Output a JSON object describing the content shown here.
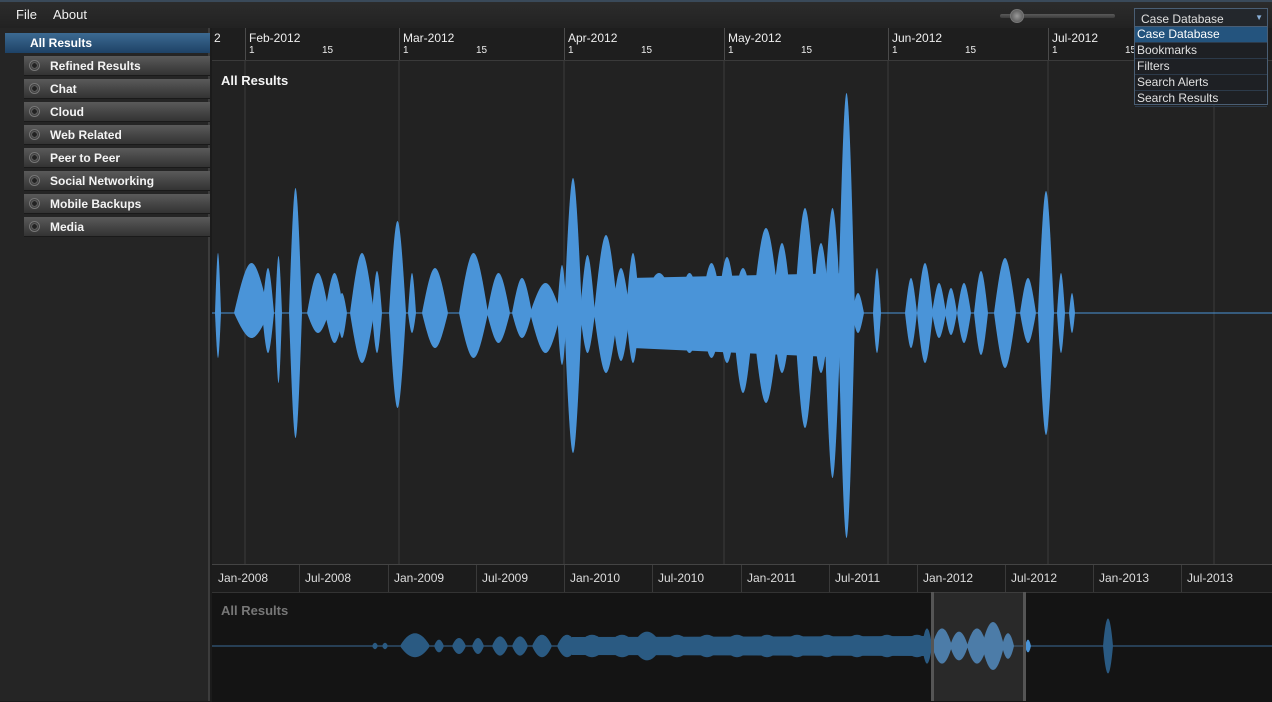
{
  "menu": {
    "file": "File",
    "about": "About"
  },
  "toolbar": {
    "zoom_icon": "magnifier-slider-icon"
  },
  "source_select": {
    "value": "Case Database",
    "options": [
      "Case Database",
      "Bookmarks",
      "Filters",
      "Search Alerts",
      "Search Results"
    ],
    "selected_index": 0
  },
  "sidebar": {
    "all_results": "All Results",
    "items": [
      "Refined Results",
      "Chat",
      "Cloud",
      "Web Related",
      "Peer to Peer",
      "Social Networking",
      "Mobile Backups",
      "Media"
    ]
  },
  "main": {
    "title": "All Results",
    "axis_edge_label": "2",
    "months": [
      "Feb-2012",
      "Mar-2012",
      "Apr-2012",
      "May-2012",
      "Jun-2012",
      "Jul-2012"
    ],
    "day_labels": [
      "1",
      "15"
    ],
    "trailing_day_label": "15"
  },
  "overview": {
    "title": "All Results",
    "labels": [
      "Jan-2008",
      "Jul-2008",
      "Jan-2009",
      "Jul-2009",
      "Jan-2010",
      "Jul-2010",
      "Jan-2011",
      "Jul-2011",
      "Jan-2012",
      "Jul-2012",
      "Jan-2013",
      "Jul-2013"
    ]
  },
  "colors": {
    "accent": "#4a94d8",
    "dim_accent": "#2a5a82",
    "selection": "#1e4266"
  }
}
